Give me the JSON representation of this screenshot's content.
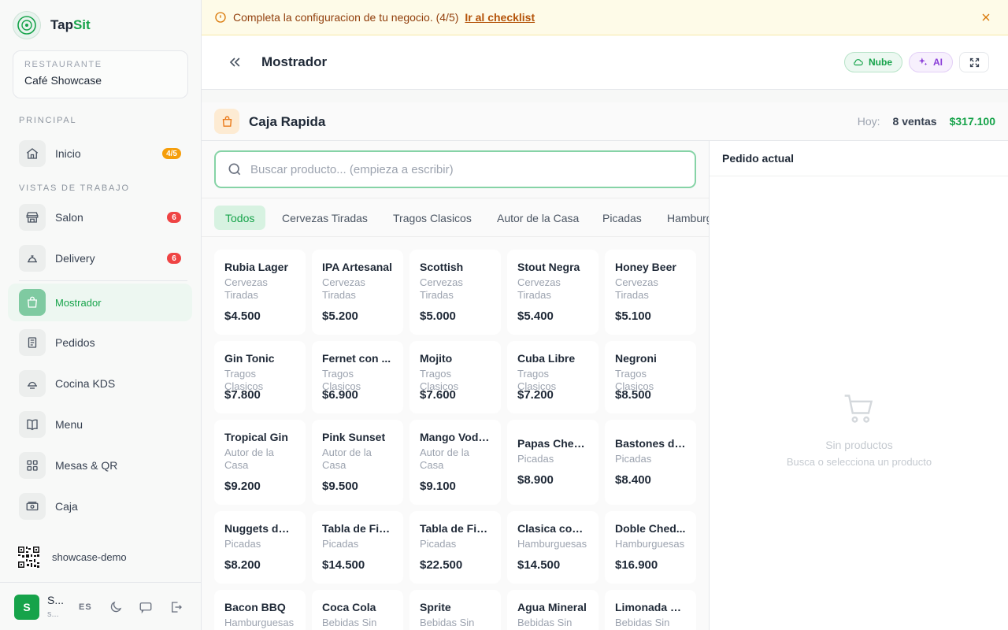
{
  "brand": {
    "prefix": "Tap",
    "accent": "Sit"
  },
  "restaurant": {
    "label": "RESTAURANTE",
    "name": "Café Showcase"
  },
  "sidebar": {
    "section_principal": "PRINCIPAL",
    "section_vistas": "VISTAS DE TRABAJO",
    "items": [
      {
        "label": "Inicio",
        "icon": "home-icon",
        "badge": "4/5"
      },
      {
        "label": "Salon",
        "icon": "store-icon",
        "badge": "6"
      },
      {
        "label": "Delivery",
        "icon": "delivery-icon",
        "badge": "6"
      },
      {
        "label": "Mostrador",
        "icon": "bag-icon"
      },
      {
        "label": "Pedidos",
        "icon": "orders-icon"
      },
      {
        "label": "Cocina KDS",
        "icon": "kitchen-icon"
      },
      {
        "label": "Menu",
        "icon": "book-icon"
      },
      {
        "label": "Mesas & QR",
        "icon": "grid-icon"
      },
      {
        "label": "Caja",
        "icon": "cash-icon"
      }
    ],
    "slug": "showcase-demo",
    "user": {
      "initial": "S",
      "name": "S...",
      "sub": "s..."
    },
    "lang": "ES"
  },
  "banner": {
    "text": "Completa la configuracion de tu negocio. (4/5)",
    "link": "Ir al checklist"
  },
  "header": {
    "title": "Mostrador",
    "cloud_label": "Nube",
    "ai_label": "AI"
  },
  "pos": {
    "title": "Caja Rapida",
    "today_label": "Hoy:",
    "sales_count": "8 ventas",
    "total": "$317.100",
    "search_placeholder": "Buscar producto... (empieza a escribir)",
    "categories": [
      "Todos",
      "Cervezas Tiradas",
      "Tragos Clasicos",
      "Autor de la Casa",
      "Picadas",
      "Hamburguesas"
    ],
    "products": [
      {
        "name": "Rubia Lager",
        "category": "Cervezas Tiradas",
        "price": "$4.500"
      },
      {
        "name": "IPA Artesanal",
        "category": "Cervezas Tiradas",
        "price": "$5.200"
      },
      {
        "name": "Scottish",
        "category": "Cervezas Tiradas",
        "price": "$5.000"
      },
      {
        "name": "Stout Negra",
        "category": "Cervezas Tiradas",
        "price": "$5.400"
      },
      {
        "name": "Honey Beer",
        "category": "Cervezas Tiradas",
        "price": "$5.100"
      },
      {
        "name": "Gin Tonic",
        "category": "Tragos Clasicos",
        "price": "$7.800"
      },
      {
        "name": "Fernet con ...",
        "category": "Tragos Clasicos",
        "price": "$6.900"
      },
      {
        "name": "Mojito",
        "category": "Tragos Clasicos",
        "price": "$7.600"
      },
      {
        "name": "Cuba Libre",
        "category": "Tragos Clasicos",
        "price": "$7.200"
      },
      {
        "name": "Negroni",
        "category": "Tragos Clasicos",
        "price": "$8.500"
      },
      {
        "name": "Tropical Gin",
        "category": "Autor de la Casa",
        "price": "$9.200"
      },
      {
        "name": "Pink Sunset",
        "category": "Autor de la Casa",
        "price": "$9.500"
      },
      {
        "name": "Mango Vodk...",
        "category": "Autor de la Casa",
        "price": "$9.100"
      },
      {
        "name": "Papas Ched...",
        "category": "Picadas",
        "price": "$8.900"
      },
      {
        "name": "Bastones de...",
        "category": "Picadas",
        "price": "$8.400"
      },
      {
        "name": "Nuggets de ...",
        "category": "Picadas",
        "price": "$8.200"
      },
      {
        "name": "Tabla de Fia...",
        "category": "Picadas",
        "price": "$14.500"
      },
      {
        "name": "Tabla de Fia...",
        "category": "Picadas",
        "price": "$22.500"
      },
      {
        "name": "Clasica con ...",
        "category": "Hamburguesas",
        "price": "$14.500"
      },
      {
        "name": "Doble Ched...",
        "category": "Hamburguesas",
        "price": "$16.900"
      },
      {
        "name": "Bacon BBQ",
        "category": "Hamburguesas",
        "price": ""
      },
      {
        "name": "Coca Cola",
        "category": "Bebidas Sin",
        "price": ""
      },
      {
        "name": "Sprite",
        "category": "Bebidas Sin",
        "price": ""
      },
      {
        "name": "Agua Mineral",
        "category": "Bebidas Sin",
        "price": ""
      },
      {
        "name": "Limonada C...",
        "category": "Bebidas Sin",
        "price": ""
      }
    ]
  },
  "order": {
    "title": "Pedido actual",
    "empty_title": "Sin productos",
    "empty_sub": "Busca o selecciona un producto"
  },
  "colors": {
    "accent": "#16a34a",
    "warning_bg": "#fefbe8",
    "badge_orange": "#f59e0b",
    "badge_red": "#ef4444",
    "ai_purple": "#8b3fd8"
  }
}
